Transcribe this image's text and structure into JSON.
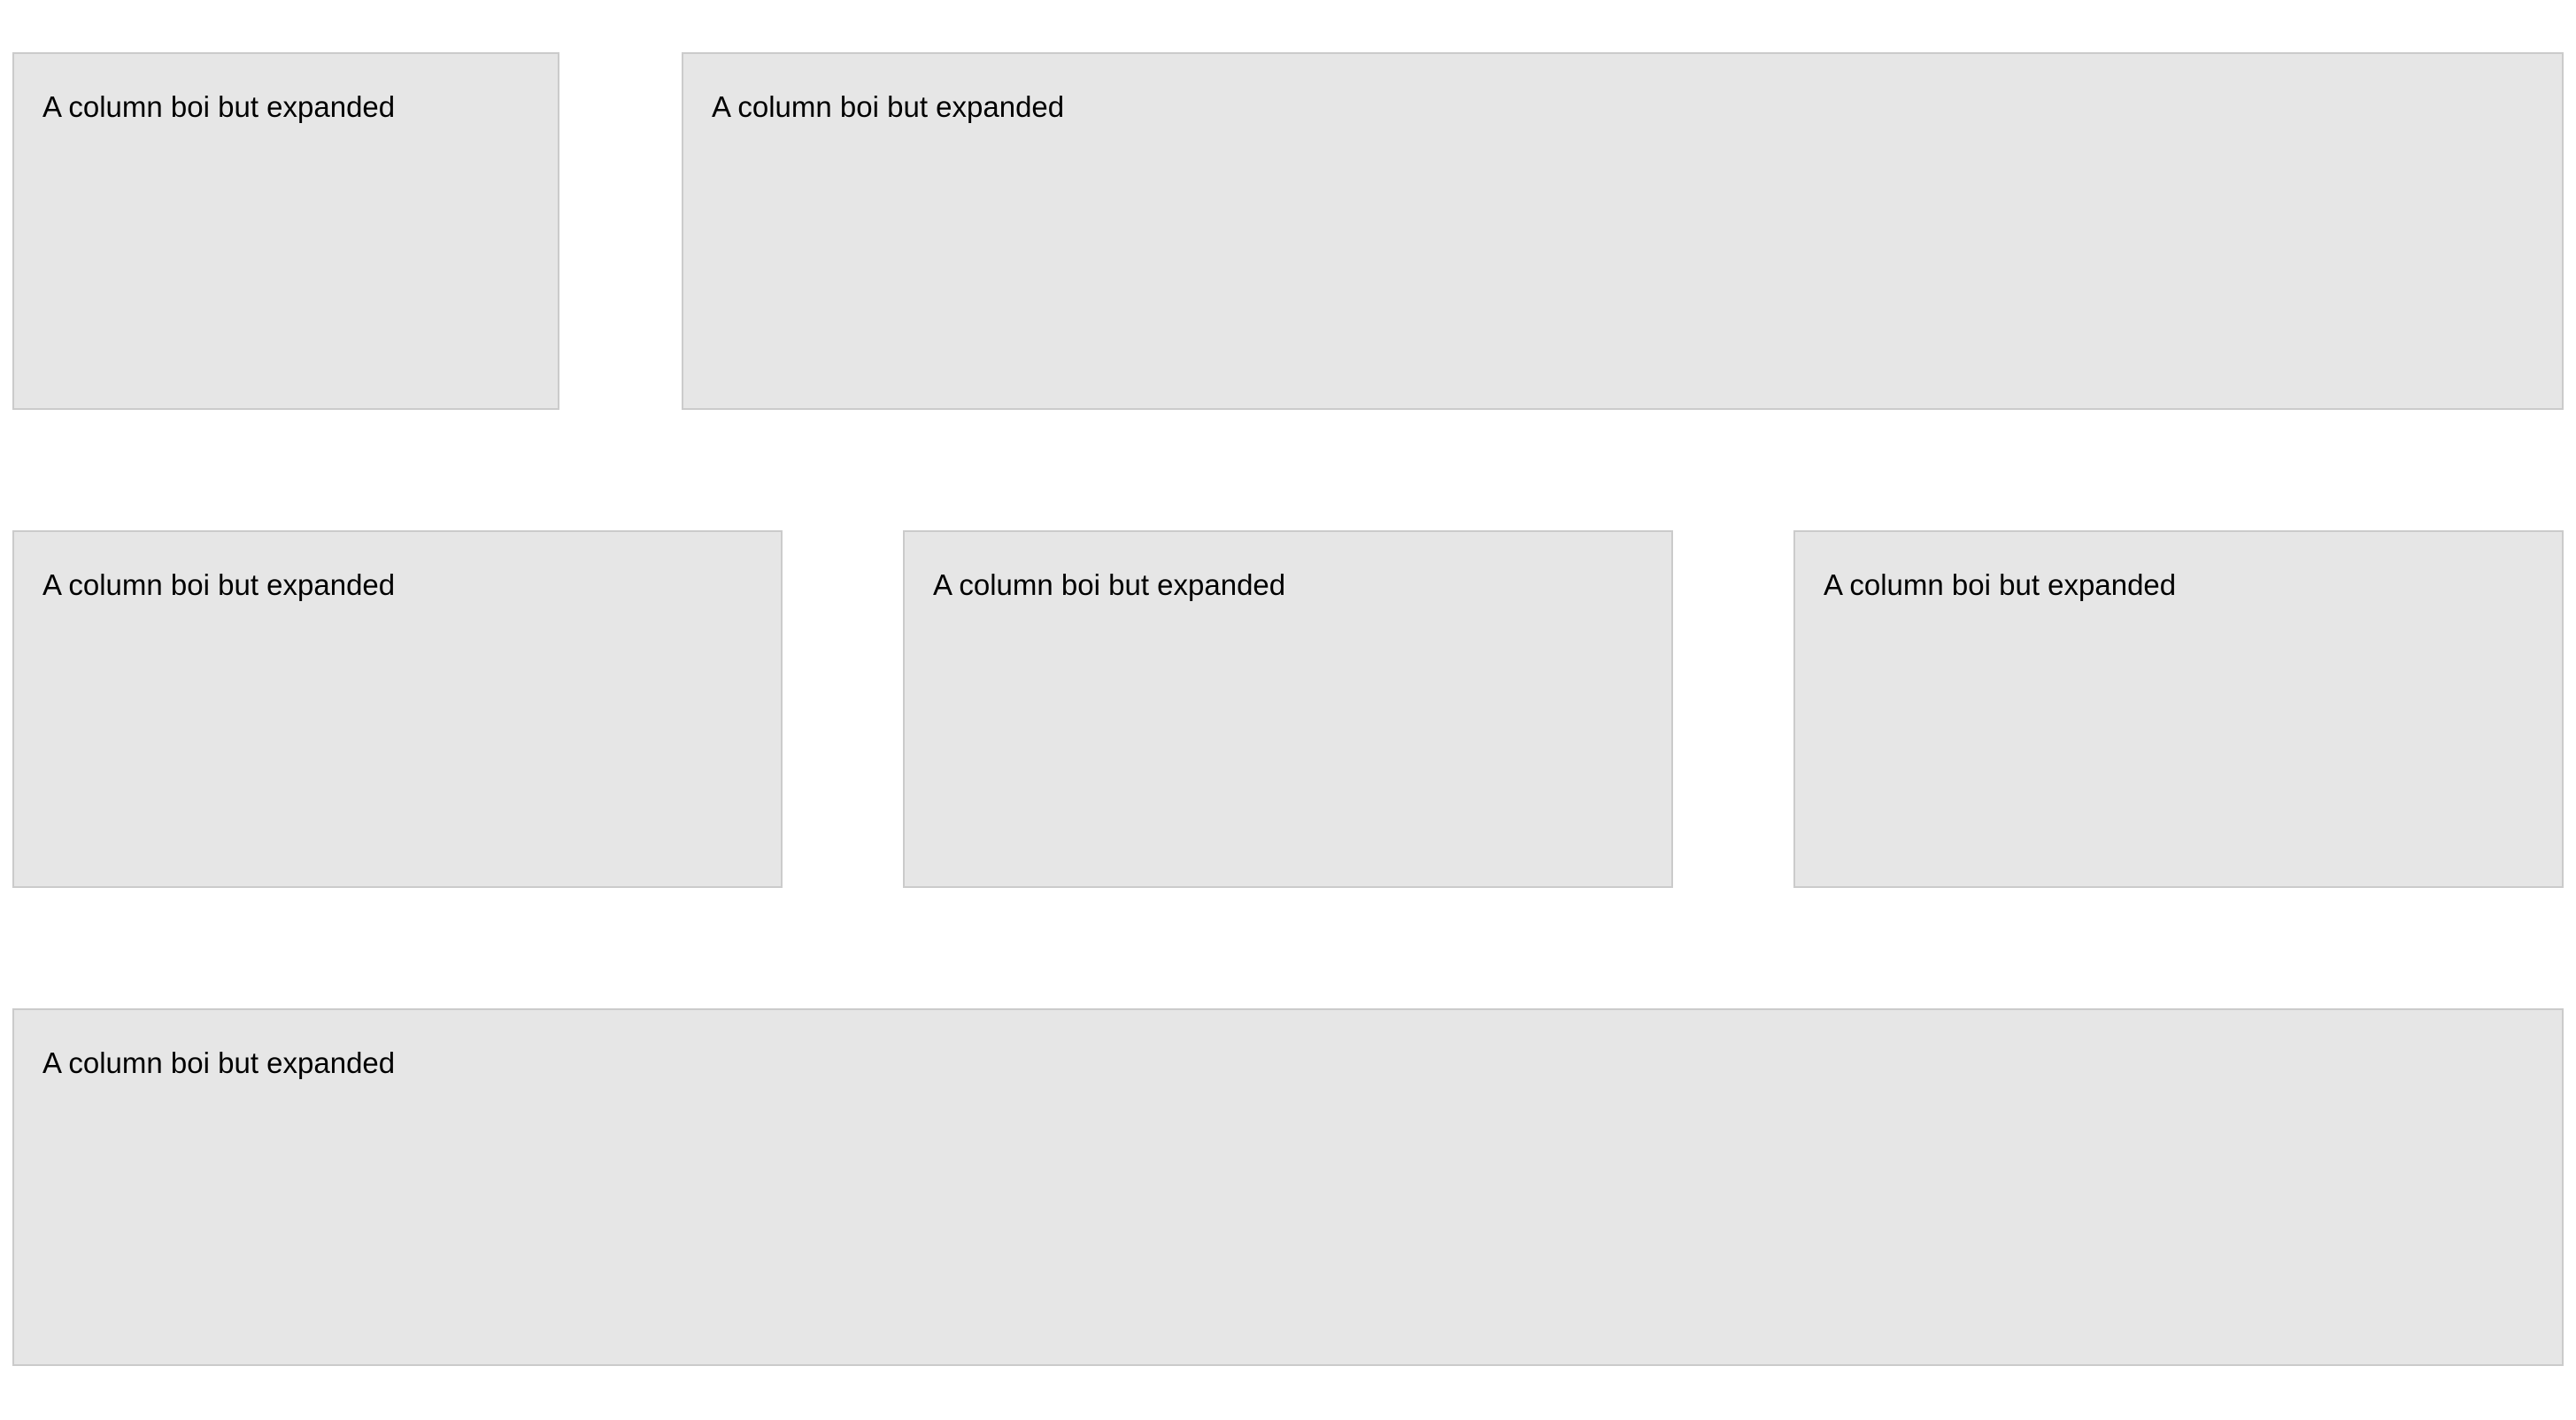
{
  "rows": [
    {
      "columns": [
        {
          "text": "A column boi but expanded"
        },
        {
          "text": "A column boi but expanded"
        }
      ]
    },
    {
      "columns": [
        {
          "text": "A column boi but expanded"
        },
        {
          "text": "A column boi but expanded"
        },
        {
          "text": "A column boi but expanded"
        }
      ]
    },
    {
      "columns": [
        {
          "text": "A column boi but expanded"
        }
      ]
    }
  ],
  "colors": {
    "page_background": "#ffffff",
    "box_background": "#e6e6e6",
    "box_border": "#cbcbcb",
    "text": "#000000"
  }
}
